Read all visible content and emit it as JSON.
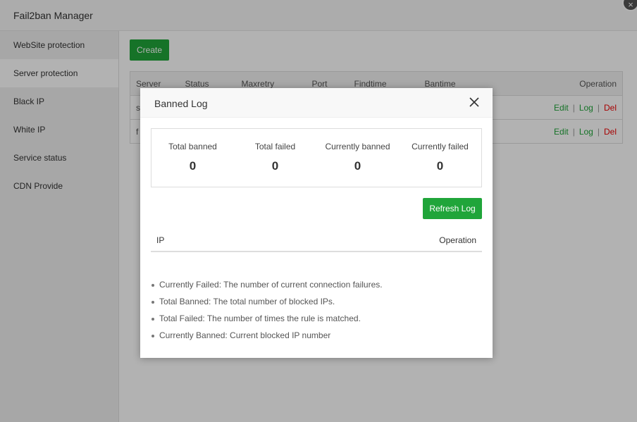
{
  "app": {
    "title": "Fail2ban Manager",
    "close_glyph": "×"
  },
  "sidebar": {
    "items": [
      {
        "label": "WebSite protection"
      },
      {
        "label": "Server protection"
      },
      {
        "label": "Black IP"
      },
      {
        "label": "White IP"
      },
      {
        "label": "Service status"
      },
      {
        "label": "CDN Provide"
      }
    ],
    "active_index": 1
  },
  "main": {
    "create_label": "Create",
    "table": {
      "headers": [
        "Server",
        "Status",
        "Maxretry",
        "Port",
        "Findtime",
        "Bantime",
        "Operation"
      ],
      "rows": [
        {
          "server": "s",
          "actions": [
            "Edit",
            "Log",
            "Del"
          ]
        },
        {
          "server": "f",
          "actions": [
            "Edit",
            "Log",
            "Del"
          ]
        }
      ],
      "separator": "|"
    }
  },
  "modal": {
    "title": "Banned Log",
    "stats": [
      {
        "label": "Total banned",
        "value": "0"
      },
      {
        "label": "Total failed",
        "value": "0"
      },
      {
        "label": "Currently banned",
        "value": "0"
      },
      {
        "label": "Currently failed",
        "value": "0"
      }
    ],
    "refresh_label": "Refresh Log",
    "list_headers": {
      "ip": "IP",
      "operation": "Operation"
    },
    "notes": [
      "Currently Failed: The number of current connection failures.",
      "Total Banned: The total number of blocked IPs.",
      "Total Failed: The number of times the rule is matched.",
      "Currently Banned:   Current blocked IP number"
    ]
  },
  "colors": {
    "accent": "#20a53a",
    "danger": "#ee0000"
  },
  "icons": {
    "modal_close": "close-icon",
    "app_close": "close-icon"
  }
}
